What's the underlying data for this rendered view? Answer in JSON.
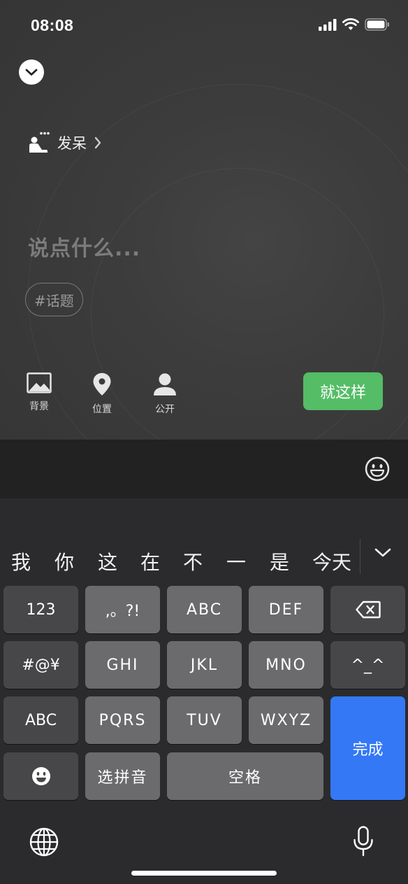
{
  "status_bar": {
    "time": "08:08",
    "icons": [
      "signal-icon",
      "wifi-icon",
      "battery-icon"
    ]
  },
  "compose": {
    "collapse_icon": "chevron-down-icon",
    "mood": {
      "icon": "daydream-icon",
      "label": "发呆"
    },
    "input_placeholder": "说点什么...",
    "topic_chip": "#话题",
    "tools": [
      {
        "icon": "image-icon",
        "label": "背景"
      },
      {
        "icon": "location-pin-icon",
        "label": "位置"
      },
      {
        "icon": "person-icon",
        "label": "公开"
      }
    ],
    "confirm_button": "就这样",
    "accent_color": "#54bd66"
  },
  "keyboard": {
    "candidates": [
      "我",
      "你",
      "这",
      "在",
      "不",
      "一",
      "是",
      "今天"
    ],
    "rows": [
      [
        "123",
        ",。?!",
        "ABC",
        "DEF",
        "backspace"
      ],
      [
        "#@¥",
        "GHI",
        "JKL",
        "MNO",
        "^^"
      ],
      [
        "ABC",
        "PQRS",
        "TUV",
        "WXYZ"
      ],
      [
        "emoji",
        "选拼音",
        "空格"
      ]
    ],
    "labels": {
      "num": "123",
      "punct": ",。?!",
      "abc": "ABC",
      "def": "DEF",
      "symbols": "#@¥",
      "ghi": "GHI",
      "jkl": "JKL",
      "mno": "MNO",
      "kaomoji": "^_^",
      "abc_switch": "ABC",
      "pqrs": "PQRS",
      "tuv": "TUV",
      "wxyz": "WXYZ",
      "pinyin": "选拼音",
      "space": "空格",
      "done": "完成"
    },
    "done_color": "#3478f6"
  }
}
